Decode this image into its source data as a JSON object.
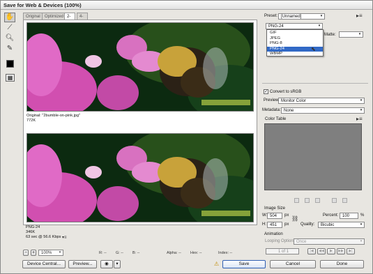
{
  "window": {
    "title": "Save for Web & Devices (100%)"
  },
  "tabs": [
    {
      "label": "Original"
    },
    {
      "label": "Optimized"
    },
    {
      "label": "2-Up"
    },
    {
      "label": "4-Up"
    }
  ],
  "panes": {
    "top": {
      "line1": "Original: \"2bumble-on-pink.jpg\"",
      "line2": "772K"
    },
    "bottom": {
      "line1": "PNG-24",
      "line2": "346K",
      "line3": "63 sec @ 56.6 Kbps"
    }
  },
  "preset": {
    "label": "Preset:",
    "value": "[Unnamed]"
  },
  "format_select": {
    "value": "PNG-24"
  },
  "format_options": [
    "GIF",
    "JPEG",
    "PNG-8",
    "PNG-24",
    "WBMP"
  ],
  "format_highlighted": "PNG-24",
  "matte": {
    "label": "Matte:"
  },
  "convert_srgb": {
    "label": "Convert to sRGB",
    "checked": true
  },
  "preview": {
    "label": "Preview:",
    "value": "Monitor Color"
  },
  "metadata": {
    "label": "Metadata:",
    "value": "None"
  },
  "color_table": {
    "title": "Color Table"
  },
  "image_size": {
    "title": "Image Size",
    "w_label": "W:",
    "w_value": "504",
    "w_unit": "px",
    "h_label": "H:",
    "h_value": "451",
    "h_unit": "px",
    "percent_label": "Percent:",
    "percent_value": "100",
    "percent_unit": "%",
    "quality_label": "Quality:",
    "quality_value": "Bicubic"
  },
  "animation": {
    "title": "Animation",
    "looping_label": "Looping Options:",
    "looping_value": "Once",
    "frame_counter": "1 of 1"
  },
  "statusbar": {
    "zoom": "100%",
    "r": "R: --",
    "g": "G: --",
    "b": "B: --",
    "alpha": "Alpha: --",
    "hex": "Hex: --",
    "index": "Index: --"
  },
  "buttons": {
    "device_central": "Device Central...",
    "preview": "Preview...",
    "save": "Save",
    "cancel": "Cancel",
    "done": "Done"
  },
  "icons": {
    "hand": "hand-icon",
    "slice_select": "slice-select-icon",
    "zoom": "zoom-icon",
    "eyedropper": "eyedropper-icon",
    "eyedropper_color": "eyedropper-color-icon",
    "toggle_slices": "toggle-slices-icon",
    "warning": "warning-icon",
    "browser": "browser-icon"
  },
  "colors": {
    "highlight": "#3169c6",
    "color_table_bg": "#7f7f7f",
    "eyedropper_color": "#000000"
  }
}
